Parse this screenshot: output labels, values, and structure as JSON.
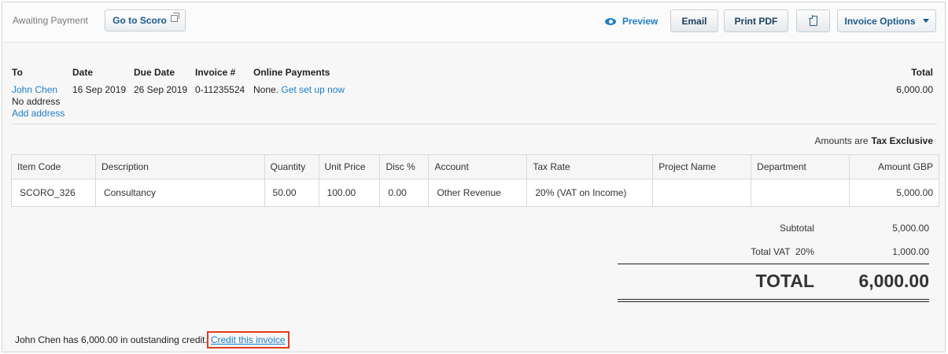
{
  "toolbar": {
    "status": "Awaiting Payment",
    "go_to_scoro": "Go to Scoro",
    "preview": "Preview",
    "email": "Email",
    "print_pdf": "Print PDF",
    "invoice_options": "Invoice Options"
  },
  "header": {
    "to_label": "To",
    "to_name": "John Chen",
    "to_address": "No address",
    "add_address": "Add address",
    "date_label": "Date",
    "date": "16 Sep 2019",
    "due_label": "Due Date",
    "due_date": "26 Sep 2019",
    "invoice_label": "Invoice #",
    "invoice_number": "0-11235524",
    "online_label": "Online Payments",
    "online_value": "None.",
    "online_link": "Get set up now",
    "total_label": "Total",
    "total_value": "6,000.00"
  },
  "amounts": {
    "prefix": "Amounts are",
    "mode": "Tax Exclusive"
  },
  "table": {
    "columns": [
      "Item Code",
      "Description",
      "Quantity",
      "Unit Price",
      "Disc %",
      "Account",
      "Tax Rate",
      "Project Name",
      "Department",
      "Amount GBP"
    ],
    "rows": [
      [
        "SCORO_326",
        "Consultancy",
        "50.00",
        "100.00",
        "0.00",
        "Other Revenue",
        "20% (VAT on Income)",
        "",
        "",
        "5,000.00"
      ]
    ]
  },
  "totals": {
    "subtotal_label": "Subtotal",
    "subtotal": "5,000.00",
    "vat_label": "Total VAT  20%",
    "vat": "1,000.00",
    "total_label": "TOTAL",
    "total": "6,000.00"
  },
  "credit": {
    "message": "John Chen has 6,000.00 in outstanding credit.",
    "link": "Credit this invoice"
  },
  "colors": {
    "link": "#1f7fc5",
    "highlight": "#e33b1b"
  },
  "icons": [
    "external-link-icon",
    "eye-icon",
    "document-icon",
    "caret-down-icon"
  ]
}
